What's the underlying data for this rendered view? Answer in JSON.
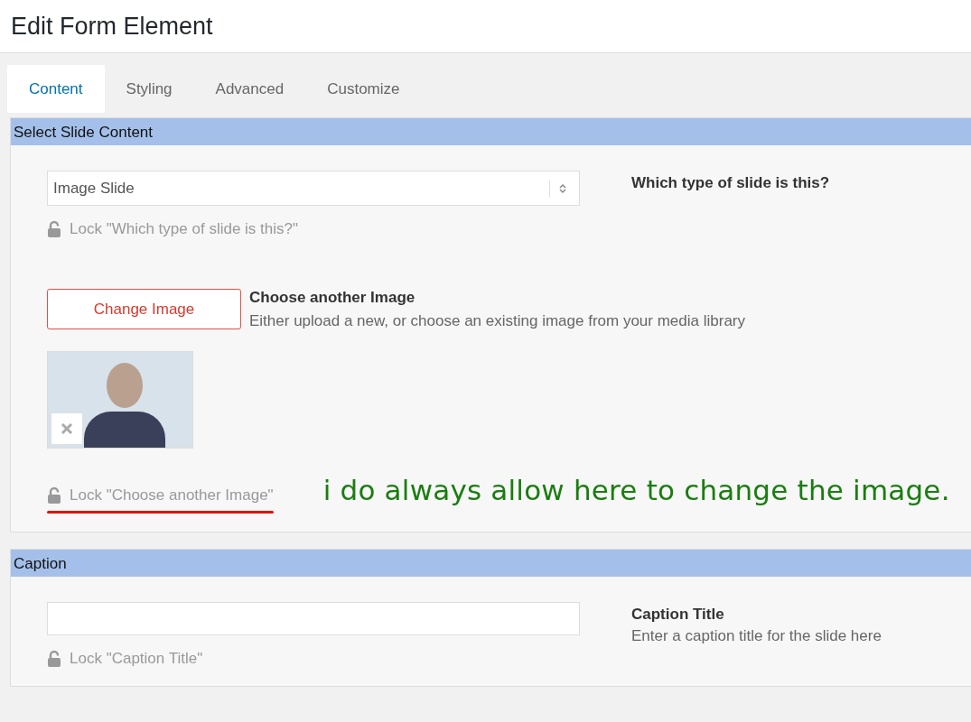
{
  "window": {
    "title": "Edit Form Element"
  },
  "tabs": [
    {
      "label": "Content",
      "selected": true
    },
    {
      "label": "Styling",
      "selected": false
    },
    {
      "label": "Advanced",
      "selected": false
    },
    {
      "label": "Customize",
      "selected": false
    }
  ],
  "sections": [
    {
      "title": "Select Slide Content",
      "fields": [
        {
          "kind": "select",
          "value": "Image Slide",
          "label": "Which type of slide is this?",
          "lock": {
            "text": "Lock \"Which type of slide is this?\"",
            "locked": false
          }
        },
        {
          "kind": "image",
          "button": "Change Image",
          "label": "Choose another Image",
          "description": "Either upload a new, or choose an existing image from your media library",
          "lock": {
            "text": "Lock \"Choose another Image\"",
            "locked": false,
            "underlined": true
          },
          "annotation": "i do always allow here to change the image."
        }
      ]
    },
    {
      "title": "Caption",
      "fields": [
        {
          "kind": "text",
          "label": "Caption Title",
          "description": "Enter a caption title for the slide here",
          "lock": {
            "text": "Lock \"Caption Title\"",
            "locked": false
          }
        }
      ]
    }
  ]
}
